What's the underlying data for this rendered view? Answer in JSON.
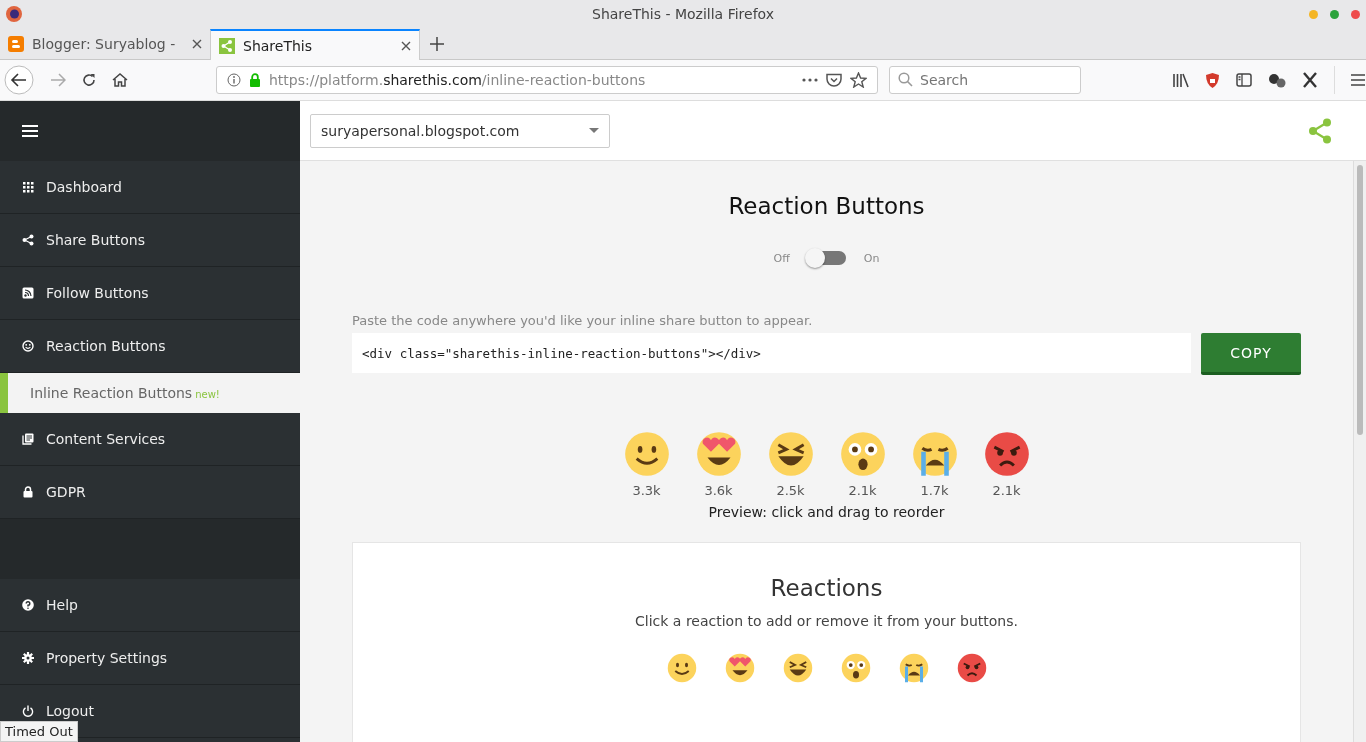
{
  "window": {
    "title": "ShareThis - Mozilla Firefox"
  },
  "tabs": [
    {
      "label": "Blogger: Suryablog -",
      "selected": false
    },
    {
      "label": "ShareThis",
      "selected": true
    }
  ],
  "address_bar": {
    "url_prefix": "https://platform.",
    "url_domain": "sharethis.com",
    "url_path": "/inline-reaction-buttons"
  },
  "search": {
    "placeholder": "Search"
  },
  "sidebar": {
    "items": [
      {
        "label": "Dashboard",
        "selected": false
      },
      {
        "label": "Share Buttons",
        "selected": false
      },
      {
        "label": "Follow Buttons",
        "selected": false
      },
      {
        "label": "Reaction Buttons",
        "selected": false,
        "children": [
          {
            "label": "Inline Reaction Buttons",
            "badge": "new!",
            "selected": true
          }
        ]
      },
      {
        "label": "Content Services",
        "selected": false
      },
      {
        "label": "GDPR",
        "selected": false
      }
    ],
    "bottom_items": [
      {
        "label": "Help"
      },
      {
        "label": "Property Settings"
      },
      {
        "label": "Logout"
      }
    ]
  },
  "property_select": {
    "value": "suryapersonal.blogspot.com"
  },
  "main": {
    "title": "Reaction Buttons",
    "toggle": {
      "off_label": "Off",
      "on_label": "On",
      "on": false
    },
    "code_hint": "Paste the code anywhere you'd like your inline share button to appear.",
    "code": "<div class=\"sharethis-inline-reaction-buttons\"></div>",
    "copy_button": "COPY",
    "preview": [
      {
        "kind": "smile",
        "count": "3.3k"
      },
      {
        "kind": "love",
        "count": "3.6k"
      },
      {
        "kind": "laugh",
        "count": "2.5k"
      },
      {
        "kind": "wow",
        "count": "2.1k"
      },
      {
        "kind": "sad",
        "count": "1.7k"
      },
      {
        "kind": "angry",
        "count": "2.1k"
      }
    ],
    "preview_caption": "Preview: click and drag to reorder"
  },
  "reactions_card": {
    "title": "Reactions",
    "subtitle": "Click a reaction to add or remove it from your buttons.",
    "reactions": [
      {
        "kind": "smile"
      },
      {
        "kind": "love"
      },
      {
        "kind": "laugh"
      },
      {
        "kind": "wow"
      },
      {
        "kind": "sad"
      },
      {
        "kind": "angry"
      }
    ]
  },
  "status_tooltip": "Timed Out"
}
